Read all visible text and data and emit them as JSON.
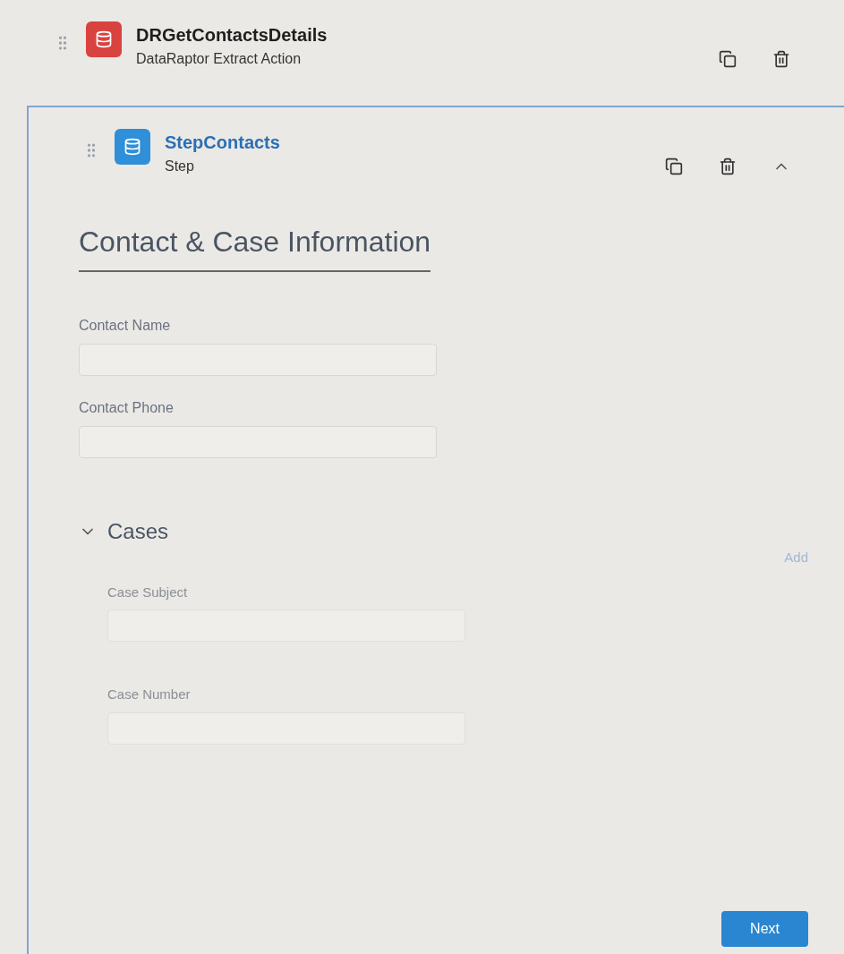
{
  "elements": [
    {
      "kind": "action",
      "title": "DRGetContactsDetails",
      "subtitle": "DataRaptor Extract Action"
    },
    {
      "kind": "step",
      "title": "StepContacts",
      "subtitle": "Step",
      "expanded": true
    }
  ],
  "form": {
    "heading": "Contact & Case Information",
    "fields": [
      {
        "label": "Contact Name"
      },
      {
        "label": "Contact Phone"
      }
    ],
    "block": {
      "title": "Cases",
      "expanded": true,
      "add_label": "Add",
      "fields": [
        {
          "label": "Case Subject"
        },
        {
          "label": "Case Number"
        }
      ]
    },
    "next_button": "Next"
  }
}
